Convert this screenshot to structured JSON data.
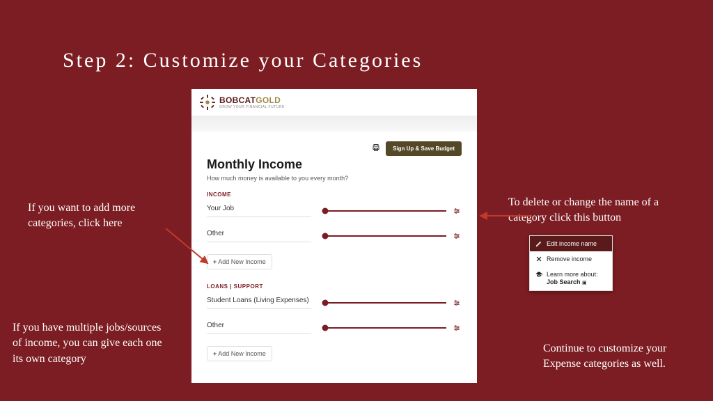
{
  "title": "Step 2: Customize your Categories",
  "annotations": {
    "add_more": "If you want to add more categories, click here",
    "multiple_jobs": "If you have multiple jobs/sources of income, you can give each one its own category",
    "delete_change": "To delete or change the name of a category click this button",
    "continue": "Continue to customize your Expense categories as well."
  },
  "app": {
    "logo": {
      "brand1": "BOBCAT",
      "brand2": "GOLD",
      "tagline": "GROW YOUR FINANCIAL FUTURE"
    },
    "signup_label": "Sign Up & Save Budget",
    "heading": "Monthly Income",
    "subheading": "How much money is available to you every month?",
    "sections": [
      {
        "label": "INCOME",
        "rows": [
          {
            "label": "Your Job"
          },
          {
            "label": "Other"
          }
        ],
        "add_label": "Add New Income"
      },
      {
        "label": "LOANS | SUPPORT",
        "rows": [
          {
            "label": "Student Loans (Living Expenses)"
          },
          {
            "label": "Other"
          }
        ],
        "add_label": "Add New Income"
      }
    ]
  },
  "popup": {
    "edit": "Edit income name",
    "remove": "Remove income",
    "learn": "Learn more about:",
    "learn_topic": "Job Search"
  }
}
